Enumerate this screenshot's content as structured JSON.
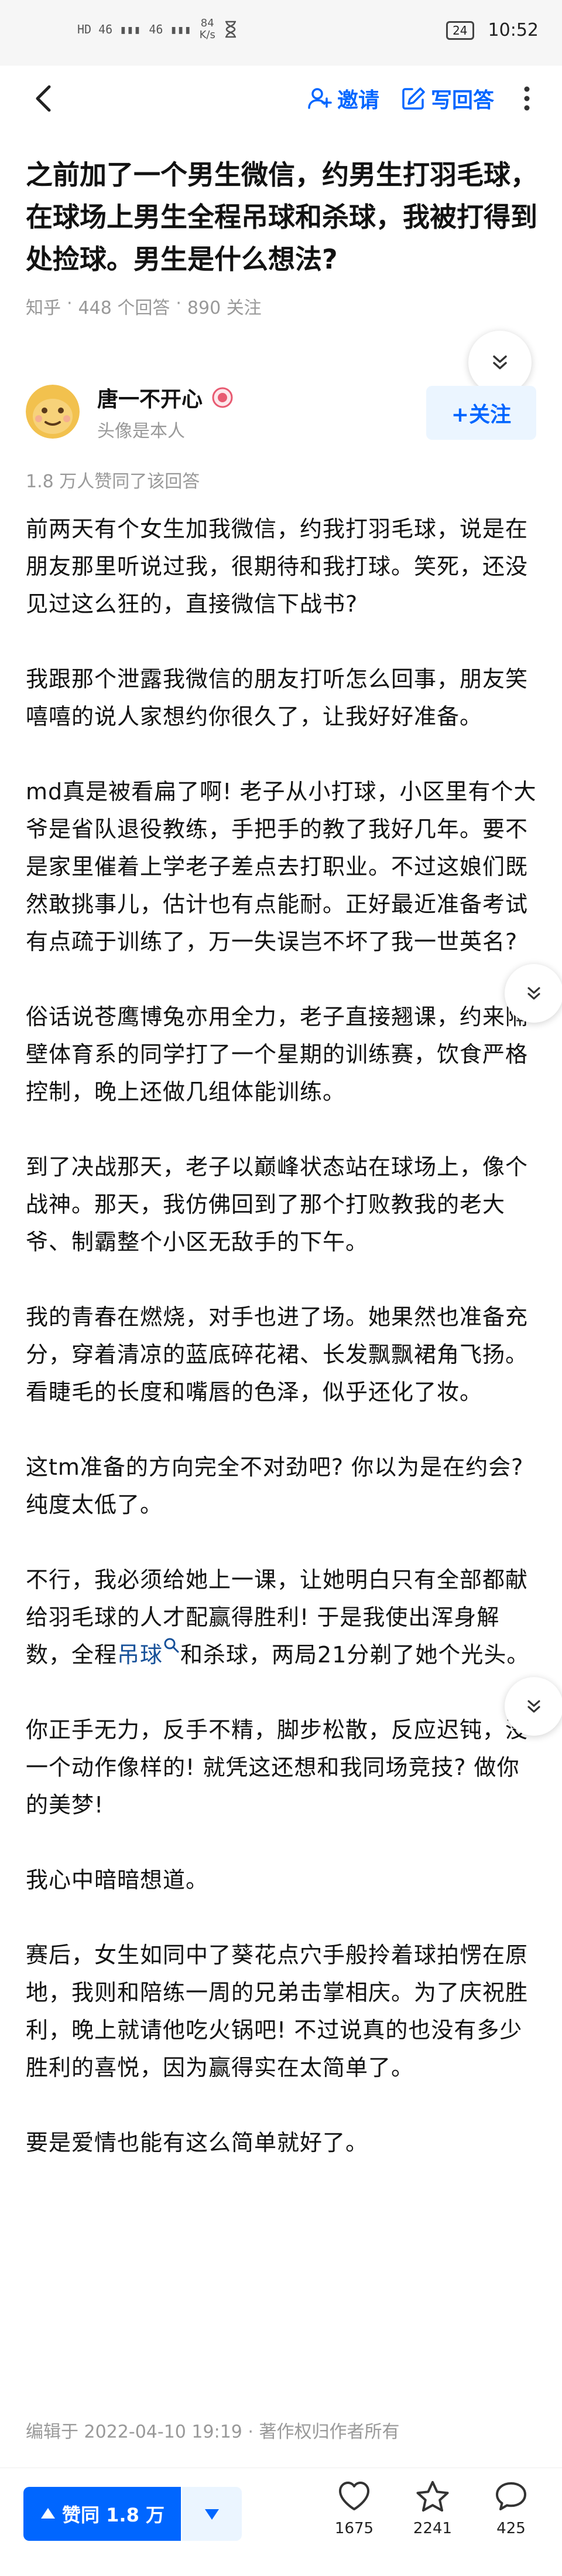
{
  "status_bar": {
    "signal_1": "HD 46 ▮▮▮",
    "signal_2": "46 ▮▮▮",
    "speed_value": "84",
    "speed_unit": "K/s",
    "battery": "24",
    "time": "10:52"
  },
  "nav": {
    "invite_label": "邀请",
    "write_answer_label": "写回答"
  },
  "question": {
    "title": "之前加了一个男生微信，约男生打羽毛球，在球场上男生全程吊球和杀球，我被打得到处捡球。男生是什么想法?",
    "source": "知乎",
    "answers": "448 个回答",
    "followers": "890 关注",
    "sep": "·"
  },
  "author": {
    "name": "唐一不开心",
    "bio": "头像是本人",
    "follow_label": "+关注",
    "upvote_note": "1.8 万人赞同了该回答"
  },
  "answer": {
    "paragraphs": [
      "前两天有个女生加我微信，约我打羽毛球，说是在朋友那里听说过我，很期待和我打球。笑死，还没见过这么狂的，直接微信下战书?",
      "我跟那个泄露我微信的朋友打听怎么回事，朋友笑嘻嘻的说人家想约你很久了，让我好好准备。",
      "md真是被看扁了啊! 老子从小打球，小区里有个大爷是省队退役教练，手把手的教了我好几年。要不是家里催着上学老子差点去打职业。不过这娘们既然敢挑事儿，估计也有点能耐。正好最近准备考试有点疏于训练了，万一失误岂不坏了我一世英名?",
      "俗话说苍鹰博兔亦用全力，老子直接翘课，约来隔壁体育系的同学打了一个星期的训练赛，饮食严格控制，晚上还做几组体能训练。",
      "到了决战那天，老子以巅峰状态站在球场上，像个战神。那天，我仿佛回到了那个打败教我的老大爷、制霸整个小区无敌手的下午。",
      "我的青春在燃烧，对手也进了场。她果然也准备充分，穿着清凉的蓝底碎花裙、长发飘飘裙角飞扬。看睫毛的长度和嘴唇的色泽，似乎还化了妆。",
      "这tm准备的方向完全不对劲吧? 你以为是在约会? 纯度太低了。"
    ],
    "p8_before": "不行，我必须给她上一课，让她明白只有全部都献给羽毛球的人才配赢得胜利! 于是我使出浑身解数，全程",
    "p8_link": "吊球",
    "p8_after": "和杀球，两局21分剃了她个光头。",
    "paragraphs_2": [
      "你正手无力，反手不精，脚步松散，反应迟钝，没一个动作像样的! 就凭这还想和我同场竞技? 做你的美梦!",
      "我心中暗暗想道。",
      "赛后，女生如同中了葵花点穴手般拎着球拍愣在原地，我则和陪练一周的兄弟击掌相庆。为了庆祝胜利，晚上就请他吃火锅吧! 不过说真的也没有多少胜利的喜悦，因为赢得实在太简单了。",
      "要是爱情也能有这么简单就好了。"
    ],
    "edit_meta": "编辑于 2022-04-10 19:19 · 著作权归作者所有"
  },
  "bottom_bar": {
    "upvote_label": "赞同 1.8 万",
    "likes": "1675",
    "favorites": "2241",
    "comments": "425"
  },
  "colors": {
    "brand_blue": "#0066ff",
    "light_blue": "#ebf5ff",
    "meta_gray": "#999999",
    "text": "#121212"
  },
  "icons": [
    "back-icon",
    "invite-icon",
    "write-icon",
    "more-icon",
    "chevron-down-icon",
    "badge-icon",
    "search-icon",
    "upvote-arrow-icon",
    "downvote-arrow-icon",
    "heart-icon",
    "star-icon",
    "comment-icon"
  ]
}
